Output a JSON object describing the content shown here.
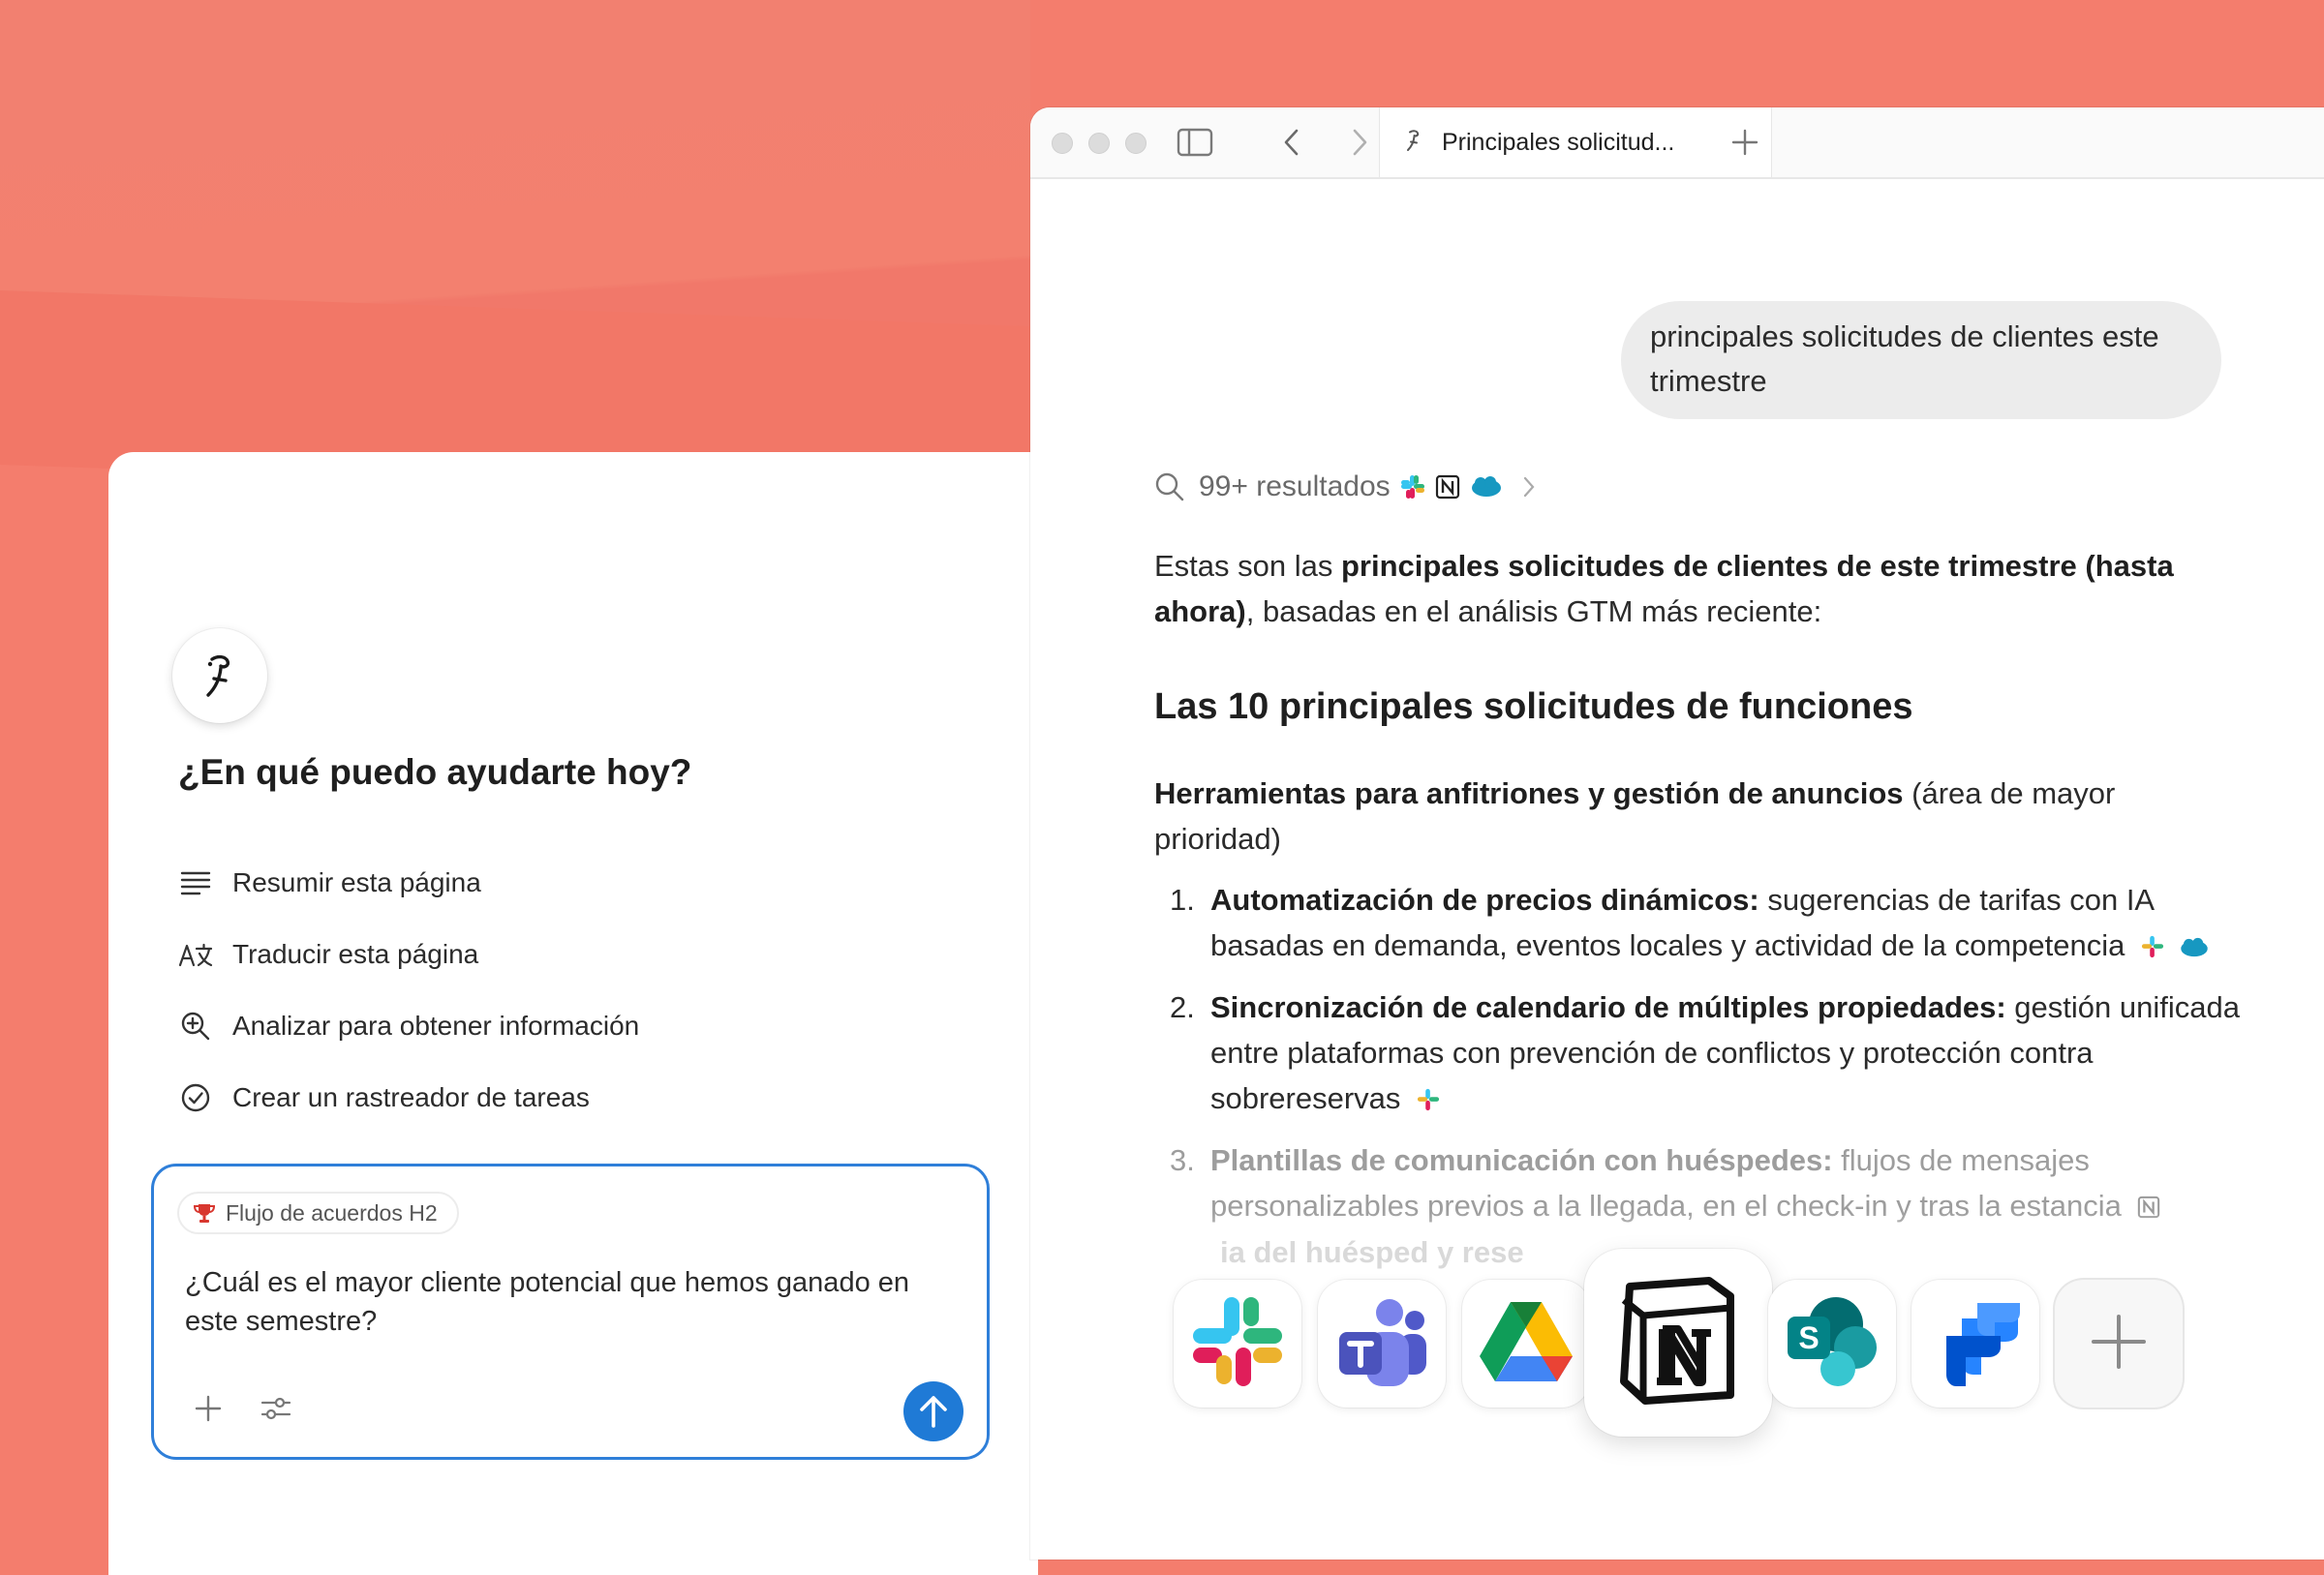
{
  "assistant_panel": {
    "greeting": "¿En qué puedo ayudarte hoy?",
    "suggestions": [
      {
        "label": "Resumir esta página",
        "icon": "lines-icon"
      },
      {
        "label": "Traducir esta página",
        "icon": "translate-icon"
      },
      {
        "label": "Analizar para obtener información",
        "icon": "zoom-in-icon"
      },
      {
        "label": "Crear un rastreador de tareas",
        "icon": "check-circle-icon"
      }
    ],
    "composer": {
      "context_chip": "Flujo de acuerdos H2",
      "text": "¿Cuál es el mayor cliente potencial que hemos ganado en este semestre?"
    }
  },
  "browser": {
    "tab_title": "Principales solicitud...",
    "user_message": "principales solicitudes de clientes este trimestre",
    "results_label": "99+ resultados",
    "intro": {
      "prefix": "Estas son las ",
      "bold": "principales solicitudes de clientes de este trimestre (hasta ahora)",
      "suffix": ", basadas en el análisis GTM más reciente:"
    },
    "heading": "Las 10 principales solicitudes de funciones",
    "section": {
      "bold": "Herramientas para anfitriones y gestión de anuncios",
      "rest": " (área de mayor prioridad)"
    },
    "items": [
      {
        "num": "1.",
        "bold": "Automatización de precios dinámicos:",
        "text": " sugerencias de tarifas con IA basadas en demanda, eventos locales y actividad de la competencia"
      },
      {
        "num": "2.",
        "bold": "Sincronización de calendario de múltiples propiedades:",
        "text": " gestión unificada entre plataformas con prevención de conflictos y protección contra sobrereservas"
      },
      {
        "num": "3.",
        "bold": "Plantillas de comunicación con huéspedes:",
        "text": " flujos de mensajes personalizables previos a la llegada, en el check-in y tras la estancia"
      }
    ],
    "ghost_text": "ia del huésped y rese"
  },
  "integrations": [
    "slack-icon",
    "teams-icon",
    "google-drive-icon",
    "notion-icon",
    "sharepoint-icon",
    "jira-icon",
    "plus-icon"
  ],
  "colors": {
    "background": "#f47d6d",
    "accent_blue": "#1f7ad6",
    "bubble": "#ececec"
  }
}
